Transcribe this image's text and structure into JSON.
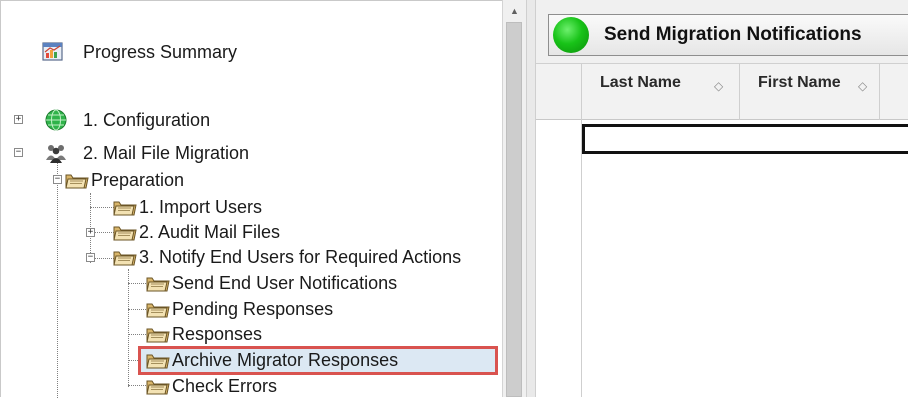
{
  "tree": {
    "progress_summary": "Progress Summary",
    "configuration": "1. Configuration",
    "mail_file_migration": "2. Mail File Migration",
    "preparation": "Preparation",
    "import_users": "1. Import Users",
    "audit_mail_files": "2. Audit Mail Files",
    "notify_end_users": "3. Notify End Users for Required Actions",
    "send_end_user_notifications": "Send End User Notifications",
    "pending_responses": "Pending Responses",
    "responses": "Responses",
    "archive_migrator_responses": "Archive Migrator Responses",
    "check_errors": "Check Errors",
    "selected_item": "Archive Migrator Responses"
  },
  "toolbar": {
    "send_button_label": "Send Migration Notifications"
  },
  "grid": {
    "columns": [
      "Last Name",
      "First Name"
    ]
  },
  "colors": {
    "selection_outline": "#d9534f",
    "selection_fill": "#dce8f3",
    "status_green": "#18c318"
  }
}
